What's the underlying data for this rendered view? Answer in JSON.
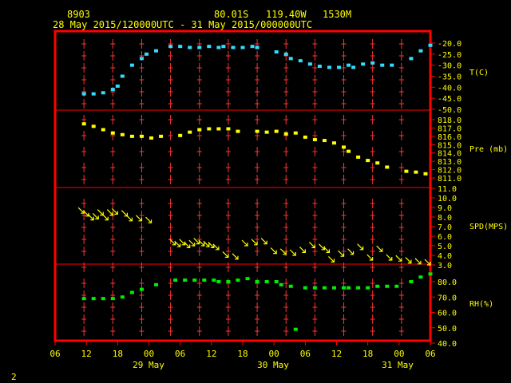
{
  "header": {
    "station": "8903",
    "location": "80.01S   119.40W",
    "elevation": "1530M",
    "period": "28 May 2015/120000UTC - 31 May 2015/000000UTC"
  },
  "footer": {
    "page_number": "2"
  },
  "colors": {
    "frame": "#ff0000",
    "axis_labels": "#ffff00",
    "header_text": "#ffff00",
    "temperature": "#33ddff",
    "pressure": "#ffff00",
    "wind": "#ffff00",
    "humidity": "#00ee00",
    "grid_marks": "#ff3333",
    "background": "#000000"
  },
  "chart_data": {
    "type": "scatter",
    "x_axis": {
      "unit": "hours UTC (3-hourly)",
      "range": [
        "28 May 2015 06",
        "31 May 2015 06"
      ],
      "tick_labels": [
        "06",
        "12",
        "18",
        "00",
        "06",
        "12",
        "18",
        "00",
        "06",
        "12",
        "18",
        "00",
        "06"
      ],
      "date_labels": [
        "29 May",
        "30 May",
        "31 May"
      ]
    },
    "panels": [
      {
        "name": "temperature",
        "label": "T(C)",
        "ylim": [
          -50,
          -20
        ],
        "tick_labels": [
          "-20.0",
          "-25.0",
          "-30.0",
          "-35.0",
          "-40.0",
          "-45.0",
          "-50.0"
        ],
        "x": [
          12,
          14,
          16,
          18,
          19,
          20,
          22,
          24,
          25,
          27,
          30,
          32,
          34,
          36,
          38,
          40,
          41,
          43,
          45,
          47,
          48,
          52,
          54,
          55,
          57,
          59,
          61,
          63,
          65,
          67,
          68,
          70,
          72,
          74,
          76,
          80,
          82,
          84
        ],
        "y": [
          -43,
          -43,
          -42.5,
          -41,
          -39.5,
          -35,
          -30,
          -27,
          -25,
          -23.5,
          -21.5,
          -21.5,
          -22,
          -22,
          -21.5,
          -22,
          -21.5,
          -22,
          -22,
          -21.5,
          -22,
          -24,
          -25,
          -27,
          -28,
          -29.5,
          -30.5,
          -31,
          -31,
          -30,
          -31,
          -29.5,
          -29,
          -30,
          -30,
          -27,
          -23.5,
          -21
        ]
      },
      {
        "name": "pressure",
        "label": "Pre (mb)",
        "ylim": [
          811,
          818
        ],
        "tick_labels": [
          "818.0",
          "817.0",
          "816.0",
          "815.0",
          "814.0",
          "813.0",
          "812.0",
          "811.0"
        ],
        "x": [
          12,
          14,
          16,
          18,
          20,
          22,
          24,
          26,
          28,
          32,
          34,
          36,
          38,
          40,
          42,
          44,
          48,
          50,
          52,
          54,
          56,
          58,
          60,
          62,
          64,
          66,
          67,
          69,
          71,
          73,
          75,
          79,
          81,
          83
        ],
        "y": [
          817.5,
          817.2,
          816.8,
          816.4,
          816.2,
          816.0,
          816.0,
          815.8,
          816.0,
          816.1,
          816.5,
          816.8,
          816.9,
          816.9,
          816.9,
          816.6,
          816.6,
          816.5,
          816.6,
          816.3,
          816.4,
          815.9,
          815.6,
          815.5,
          815.2,
          814.7,
          814.2,
          813.5,
          813.1,
          812.8,
          812.3,
          811.8,
          811.7,
          811.5
        ]
      },
      {
        "name": "wind",
        "label": "SPD(MPS)",
        "ylim": [
          3,
          11
        ],
        "tick_labels": [
          "11.0",
          "10.0",
          "9.0",
          "8.0",
          "7.0",
          "6.0",
          "5.0",
          "4.0",
          "3.0"
        ],
        "x": [
          12,
          13,
          14,
          15,
          16,
          17,
          18,
          19,
          21,
          22,
          24,
          26,
          31,
          32,
          33,
          34,
          35,
          36,
          37,
          38,
          39,
          40,
          42,
          44,
          46,
          48,
          50,
          52,
          54,
          56,
          58,
          60,
          62,
          63,
          64,
          66,
          68,
          70,
          72,
          74,
          76,
          78,
          80,
          82,
          84
        ],
        "y": [
          8.4,
          8.1,
          7.7,
          7.8,
          8.2,
          7.7,
          8.2,
          8.3,
          8.1,
          7.6,
          7.6,
          7.4,
          5.1,
          4.9,
          5.1,
          4.8,
          5.0,
          5.2,
          5.0,
          4.9,
          4.8,
          4.6,
          3.8,
          3.6,
          5.0,
          5.1,
          5.2,
          4.2,
          4.1,
          4.0,
          4.3,
          4.8,
          4.6,
          4.3,
          3.3,
          3.9,
          4.1,
          4.6,
          3.5,
          4.4,
          3.5,
          3.4,
          3.2,
          3.1,
          3.0
        ]
      },
      {
        "name": "humidity",
        "label": "RH(%)",
        "ylim": [
          40,
          90
        ],
        "tick_labels": [
          "80.0",
          "70.0",
          "60.0",
          "50.0",
          "40.0"
        ],
        "x": [
          12,
          14,
          16,
          18,
          20,
          22,
          24,
          27,
          31,
          33,
          35,
          37,
          39,
          40,
          42,
          44,
          46,
          48,
          50,
          52,
          53,
          55,
          56,
          58,
          60,
          62,
          64,
          66,
          67,
          69,
          71,
          73,
          75,
          77,
          80,
          82,
          84
        ],
        "y": [
          69,
          69,
          69,
          69,
          70,
          73,
          75,
          78,
          81,
          81,
          81,
          81,
          81,
          80,
          80,
          81,
          82,
          80,
          80,
          80,
          78,
          77,
          49,
          76,
          76,
          76,
          76,
          76,
          76,
          76,
          76,
          77,
          77,
          77,
          80,
          83,
          85
        ]
      }
    ]
  }
}
